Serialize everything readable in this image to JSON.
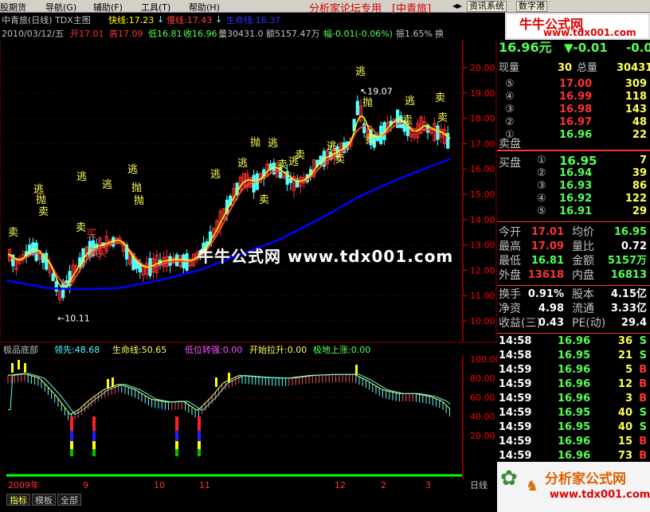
{
  "menu": {
    "items": [
      "股期货",
      "导航(G)",
      "辅助(F)",
      "工具(T)",
      "帮助(H)"
    ],
    "window_title": "分析家论坛专用",
    "window_title_tag": "[中青旅]",
    "sys_btn_1": "资讯系统",
    "sys_btn_2": "数字港"
  },
  "chart_header": {
    "title": "中青旅(日线) TDX主图",
    "fast_line": "快线:17.23",
    "slow_line": "慢线:17.43",
    "life_line": "生命线:16.37",
    "date": "2010/03/12/五",
    "open": "开17.01",
    "high": "高17.09",
    "low": "低16.81",
    "close": "收16.96",
    "volume": "量30431.0",
    "amount": "额5157.47万",
    "change": "幅-0.01(-0.06%)",
    "amplitude": "振1.65%",
    "extra": "换"
  },
  "main_axis": {
    "labels": [
      "20.00",
      "19.00",
      "18.00",
      "17.00",
      "16.00",
      "15.00",
      "14.00",
      "13.00",
      "12.00",
      "11.00",
      "10.00"
    ]
  },
  "main_annotations": {
    "high_label": "19.07",
    "low_label": "10.11",
    "signals": [
      {
        "text": "逃"
      },
      {
        "text": "抛"
      },
      {
        "text": "卖"
      },
      {
        "text": "逃"
      },
      {
        "text": "逃"
      },
      {
        "text": "抛"
      },
      {
        "text": "逃"
      },
      {
        "text": "抛"
      },
      {
        "text": "卖"
      },
      {
        "text": "买"
      },
      {
        "text": "买"
      },
      {
        "text": "卖"
      },
      {
        "text": "买"
      },
      {
        "text": "逃"
      },
      {
        "text": "抛"
      },
      {
        "text": "逃"
      },
      {
        "text": "逃"
      },
      {
        "text": "卖"
      },
      {
        "text": "逃"
      },
      {
        "text": "卖"
      },
      {
        "text": "卖"
      },
      {
        "text": "逃"
      },
      {
        "text": "逃"
      },
      {
        "text": "抛"
      },
      {
        "text": "卖"
      },
      {
        "text": "卖"
      },
      {
        "text": "逃"
      },
      {
        "text": "卖"
      },
      {
        "text": "卖"
      },
      {
        "text": "卖"
      }
    ]
  },
  "watermark": {
    "site_text": "牛牛公式网  www.tdx001.com",
    "logo_text": "牛牛公式网",
    "logo_url": "www.tdx001.com",
    "bottom_logo_text": "分析家公式网",
    "bottom_logo_url": "www.tdx001.com"
  },
  "indicator": {
    "name": "极品底部",
    "lead": "领先:48.68",
    "life": "生命线:50.65",
    "low_turn": "低位转强:0.00",
    "pull": "开始拉升:0.00",
    "bottom_up": "极地上涨:0.00",
    "axis": [
      "100.00",
      "80.00",
      "60.00",
      "40.00",
      "20.00"
    ]
  },
  "time_axis": {
    "labels": [
      "2009年",
      "9",
      "10",
      "11",
      "12",
      "2",
      "3"
    ],
    "period": "日线"
  },
  "bottom_tabs": [
    "指标",
    "模板",
    "全部"
  ],
  "quote_panel": {
    "price": "16.96元",
    "change": "▼-0.01",
    "change_pct": "-0.06",
    "now_vol_label": "现量",
    "now_vol": "30",
    "total_vol_label": "总量",
    "total_vol": "30431",
    "asks": [
      {
        "lvl": "⑤",
        "price": "17.00",
        "vol": "309"
      },
      {
        "lvl": "④",
        "price": "16.99",
        "vol": "118"
      },
      {
        "lvl": "③",
        "price": "16.98",
        "vol": "143"
      },
      {
        "lvl": "②",
        "price": "16.97",
        "vol": "48"
      },
      {
        "lvl": "①",
        "price": "16.96",
        "vol": "22"
      }
    ],
    "ask_label": "卖盘",
    "bid_label": "买盘",
    "bids": [
      {
        "lvl": "①",
        "price": "16.95",
        "vol": "7"
      },
      {
        "lvl": "②",
        "price": "16.94",
        "vol": "39"
      },
      {
        "lvl": "③",
        "price": "16.93",
        "vol": "86"
      },
      {
        "lvl": "④",
        "price": "16.92",
        "vol": "122"
      },
      {
        "lvl": "⑤",
        "price": "16.91",
        "vol": "29"
      }
    ],
    "stats": [
      {
        "l1": "今开",
        "v1": "17.01",
        "l2": "均价",
        "v2": "16.95"
      },
      {
        "l1": "最高",
        "v1": "17.09",
        "l2": "量比",
        "v2": "0.72"
      },
      {
        "l1": "最低",
        "v1": "16.81",
        "l2": "金额",
        "v2": "5157万"
      },
      {
        "l1": "外盘",
        "v1": "13618",
        "l2": "内盘",
        "v2": "16813"
      },
      {
        "l1": "换手",
        "v1": "0.91%",
        "l2": "股本",
        "v2": "4.15亿"
      },
      {
        "l1": "净资",
        "v1": "4.98",
        "l2": "流通",
        "v2": "3.33亿"
      },
      {
        "l1": "收益(三)",
        "v1": "0.43",
        "l2": "PE(动)",
        "v2": "29.4"
      }
    ],
    "ticks": [
      {
        "time": "14:58",
        "price": "16.96",
        "vol": "36",
        "dir": "S"
      },
      {
        "time": "14:58",
        "price": "16.95",
        "vol": "21",
        "dir": "S"
      },
      {
        "time": "14:59",
        "price": "16.96",
        "vol": "5",
        "dir": "B"
      },
      {
        "time": "14:59",
        "price": "16.96",
        "vol": "12",
        "dir": "B"
      },
      {
        "time": "14:59",
        "price": "16.96",
        "vol": "3",
        "dir": "B"
      },
      {
        "time": "14:59",
        "price": "16.95",
        "vol": "40",
        "dir": "S"
      },
      {
        "time": "14:59",
        "price": "16.95",
        "vol": "40",
        "dir": "S"
      },
      {
        "time": "14:59",
        "price": "16.96",
        "vol": "15",
        "dir": "B"
      },
      {
        "time": "14:59",
        "price": "16.96",
        "vol": "73",
        "dir": "B"
      },
      {
        "time": "14:59",
        "price": "16.96",
        "vol": "",
        "dir": ""
      }
    ]
  },
  "colors": {
    "up": "#ff3232",
    "down": "#54ffff",
    "fast": "#ffff00",
    "slow": "#ff4040",
    "life": "#0000ff",
    "grid": "#800000",
    "axis": "#ff0000"
  }
}
